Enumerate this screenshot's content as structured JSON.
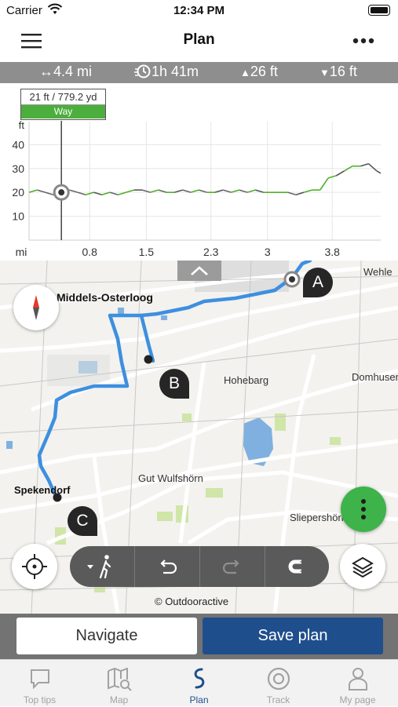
{
  "status": {
    "carrier": "Carrier",
    "time": "12:34 PM"
  },
  "header": {
    "title": "Plan",
    "menu_icon": "hamburger-icon",
    "more_icon": "more-dots-icon"
  },
  "stats": {
    "distance": "4.4 mi",
    "duration": "1h 41m",
    "ascent": "26 ft",
    "descent": "16 ft"
  },
  "elevation_tooltip": {
    "value": "21 ft / 779.2 yd",
    "surface": "Way"
  },
  "chart_data": {
    "type": "line",
    "ylabel": "ft",
    "xlabel": "mi",
    "y_ticks": [
      10,
      20,
      30,
      40
    ],
    "x_ticks": [
      0.8,
      1.5,
      2.3,
      3,
      3.8
    ],
    "ylim": [
      0,
      48
    ],
    "xlim": [
      0.05,
      4.4
    ],
    "grid": true,
    "cursor_x": 0.45,
    "series": [
      {
        "x": [
          0.05,
          0.15,
          0.25,
          0.35,
          0.45,
          0.55,
          0.65,
          0.75,
          0.85,
          0.95,
          1.05,
          1.15,
          1.25,
          1.35,
          1.45,
          1.55,
          1.65,
          1.75,
          1.85,
          1.95,
          2.05,
          2.15,
          2.25,
          2.35,
          2.45,
          2.55,
          2.65,
          2.75,
          2.85,
          2.95,
          3.05,
          3.15,
          3.25,
          3.35,
          3.45,
          3.55,
          3.65,
          3.75,
          3.85,
          3.95,
          4.05,
          4.15,
          4.25,
          4.35,
          4.4
        ],
        "values": [
          20,
          21,
          20,
          19,
          20,
          21,
          20,
          19,
          20,
          19,
          20,
          19,
          20,
          21,
          21,
          20,
          21,
          20,
          20,
          21,
          20,
          21,
          20,
          20,
          21,
          20,
          21,
          20,
          21,
          20,
          20,
          20,
          20,
          19,
          20,
          21,
          21,
          26,
          27,
          29,
          31,
          31,
          32,
          29,
          28
        ]
      }
    ]
  },
  "map": {
    "labels": [
      {
        "text": "Middels-Osterloog",
        "bold": true
      },
      {
        "text": "Wehle",
        "bold": false
      },
      {
        "text": "Hohebarg",
        "bold": false
      },
      {
        "text": "Domhusen",
        "bold": false
      },
      {
        "text": "Gut Wulfshörn",
        "bold": false
      },
      {
        "text": "Spekendorf",
        "bold": true
      },
      {
        "text": "Sliepershörn",
        "bold": false
      }
    ],
    "waypoints": [
      "A",
      "B",
      "C"
    ],
    "attribution": "© Outdooractive",
    "accent_color": "#3d8fe0"
  },
  "actions": {
    "navigate": "Navigate",
    "save": "Save plan"
  },
  "tabs": [
    {
      "label": "Top tips"
    },
    {
      "label": "Map"
    },
    {
      "label": "Plan"
    },
    {
      "label": "Track"
    },
    {
      "label": "My page"
    }
  ],
  "colors": {
    "brand": "#1f4e8c",
    "fab": "#3db34a",
    "elev_green": "#4caf2a"
  }
}
